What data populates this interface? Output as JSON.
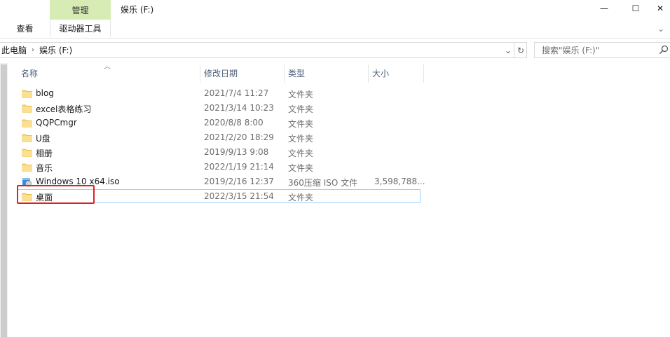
{
  "window": {
    "title": "娱乐 (F:)",
    "controls": {
      "minimize": "—",
      "maximize": "☐",
      "close": "✕"
    }
  },
  "ribbon": {
    "contextual_tab_group": "管理",
    "tabs": [
      "查看",
      "驱动器工具"
    ],
    "expand_glyph": "⌄",
    "contextual_color": "#d7ecb4"
  },
  "address_bar": {
    "breadcrumbs": [
      "此电脑",
      "娱乐 (F:)"
    ],
    "separator": "›",
    "dropdown_glyph": "⌄",
    "refresh_glyph": "↻"
  },
  "search": {
    "placeholder": "搜索\"娱乐 (F:)\""
  },
  "columns": {
    "name": "名称",
    "modified": "修改日期",
    "type": "类型",
    "size": "大小",
    "sort_glyph": "︿"
  },
  "files": [
    {
      "name": "blog",
      "modified": "2021/7/4 11:27",
      "type": "文件夹",
      "size": "",
      "icon": "folder-icon"
    },
    {
      "name": "excel表格练习",
      "modified": "2021/3/14 10:23",
      "type": "文件夹",
      "size": "",
      "icon": "folder-icon"
    },
    {
      "name": "QQPCmgr",
      "modified": "2020/8/8 8:00",
      "type": "文件夹",
      "size": "",
      "icon": "folder-icon"
    },
    {
      "name": "U盘",
      "modified": "2021/2/20 18:29",
      "type": "文件夹",
      "size": "",
      "icon": "folder-icon"
    },
    {
      "name": "相册",
      "modified": "2019/9/13 9:08",
      "type": "文件夹",
      "size": "",
      "icon": "folder-icon"
    },
    {
      "name": "音乐",
      "modified": "2022/1/19 21:14",
      "type": "文件夹",
      "size": "",
      "icon": "folder-icon"
    },
    {
      "name": "Windows 10 x64.iso",
      "modified": "2019/2/16 12:37",
      "type": "360压缩 ISO 文件",
      "size": "3,598,788...",
      "icon": "iso-file-icon"
    },
    {
      "name": "桌面",
      "modified": "2022/3/15 21:54",
      "type": "文件夹",
      "size": "",
      "icon": "folder-icon"
    }
  ],
  "selected_file": "桌面",
  "colors": {
    "folder": "#f8d775",
    "folder_edge": "#e2b33c",
    "selection_border": "#99d1ff",
    "annotation": "#e02020"
  }
}
